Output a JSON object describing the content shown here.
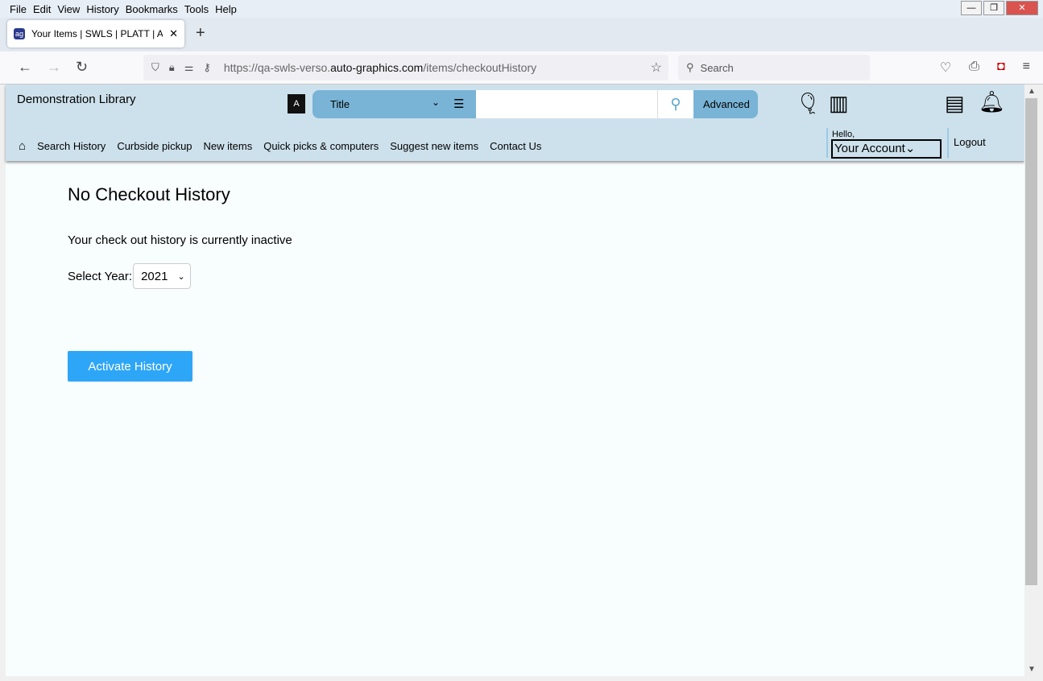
{
  "browser": {
    "menu": [
      "File",
      "Edit",
      "View",
      "History",
      "Bookmarks",
      "Tools",
      "Help"
    ],
    "tab_title": "Your Items | SWLS | PLATT | Auto-Graphics",
    "url_prefix": "https://qa-swls-verso.",
    "url_domain": "auto-graphics.com",
    "url_path": "/items/checkoutHistory",
    "search_placeholder": "Search"
  },
  "header": {
    "library_name": "Demonstration Library",
    "search_type": "Title",
    "search_value": "",
    "advanced_label": "Advanced",
    "nav": [
      "Search History",
      "Curbside pickup",
      "New items",
      "Quick picks & computers",
      "Suggest new items",
      "Contact Us"
    ],
    "hello": "Hello,",
    "account": "Your Account",
    "logout": "Logout"
  },
  "main": {
    "title": "No Checkout History",
    "message": "Your check out history is currently inactive",
    "year_label": "Select Year:",
    "year": "2021",
    "activate_label": "Activate History"
  },
  "colors": {
    "header_bg": "#cde1ec",
    "search_bar": "#79b4d6",
    "activate_button": "#2ea6f7"
  }
}
